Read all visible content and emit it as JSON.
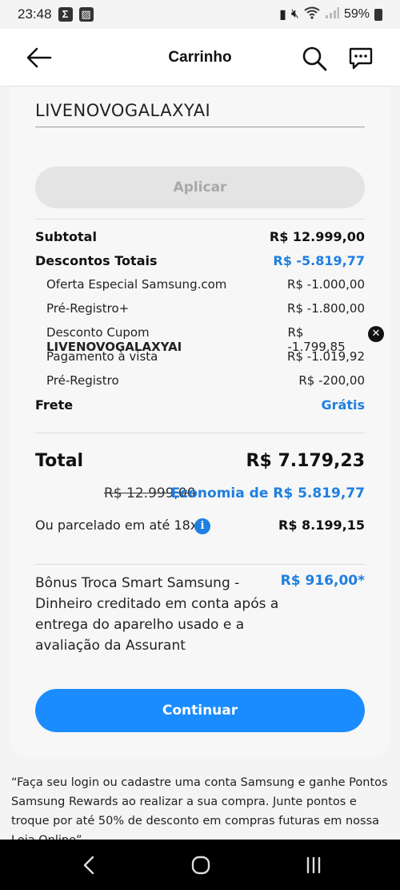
{
  "status_bar": {
    "time": "23:48",
    "battery": "59%"
  },
  "header": {
    "title": "Carrinho"
  },
  "coupon": {
    "code": "LIVENOVOGALAXYAI",
    "apply_label": "Aplicar"
  },
  "summary": {
    "subtotal_label": "Subtotal",
    "subtotal_value": "R$ 12.999,00",
    "discounts_label": "Descontos Totais",
    "discounts_value": "R$ -5.819,77",
    "discount_items": [
      {
        "label": "Oferta Especial Samsung.com",
        "value": "R$ -1.000,00"
      },
      {
        "label": "Pré-Registro+",
        "value": "R$ -1.800,00"
      },
      {
        "label_prefix": "Desconto Cupom ",
        "label_code": "LIVENOVOGALAXYAI",
        "value": "R$ -1.799,85"
      },
      {
        "label": "Pagamento à vista",
        "value": "R$ -1.019,92"
      },
      {
        "label": "Pré-Registro",
        "value": "R$ -200,00"
      }
    ],
    "shipping_label": "Frete",
    "shipping_value": "Grátis"
  },
  "total": {
    "label": "Total",
    "value": "R$ 7.179,23",
    "old_price": "R$ 12.999,00",
    "economy": "Economia de R$ 5.819,77",
    "installment_label": "Ou parcelado em até 18x",
    "installment_value": "R$ 8.199,15"
  },
  "bonus": {
    "text": "Bônus Troca Smart Samsung - Dinheiro creditado em conta após a entrega do aparelho usado e a avaliação da Assurant",
    "value": "R$ 916,00*"
  },
  "actions": {
    "continue_label": "Continuar"
  },
  "promo_text": "“Faça seu login ou cadastre uma conta Samsung e ganhe Pontos Samsung Rewards ao realizar a sua compra. Junte pontos e troque por até 50% de desconto em compras futuras em nossa Loja Online”.",
  "colors": {
    "accent": "#1a8cff",
    "link_blue": "#1e7fe0"
  }
}
